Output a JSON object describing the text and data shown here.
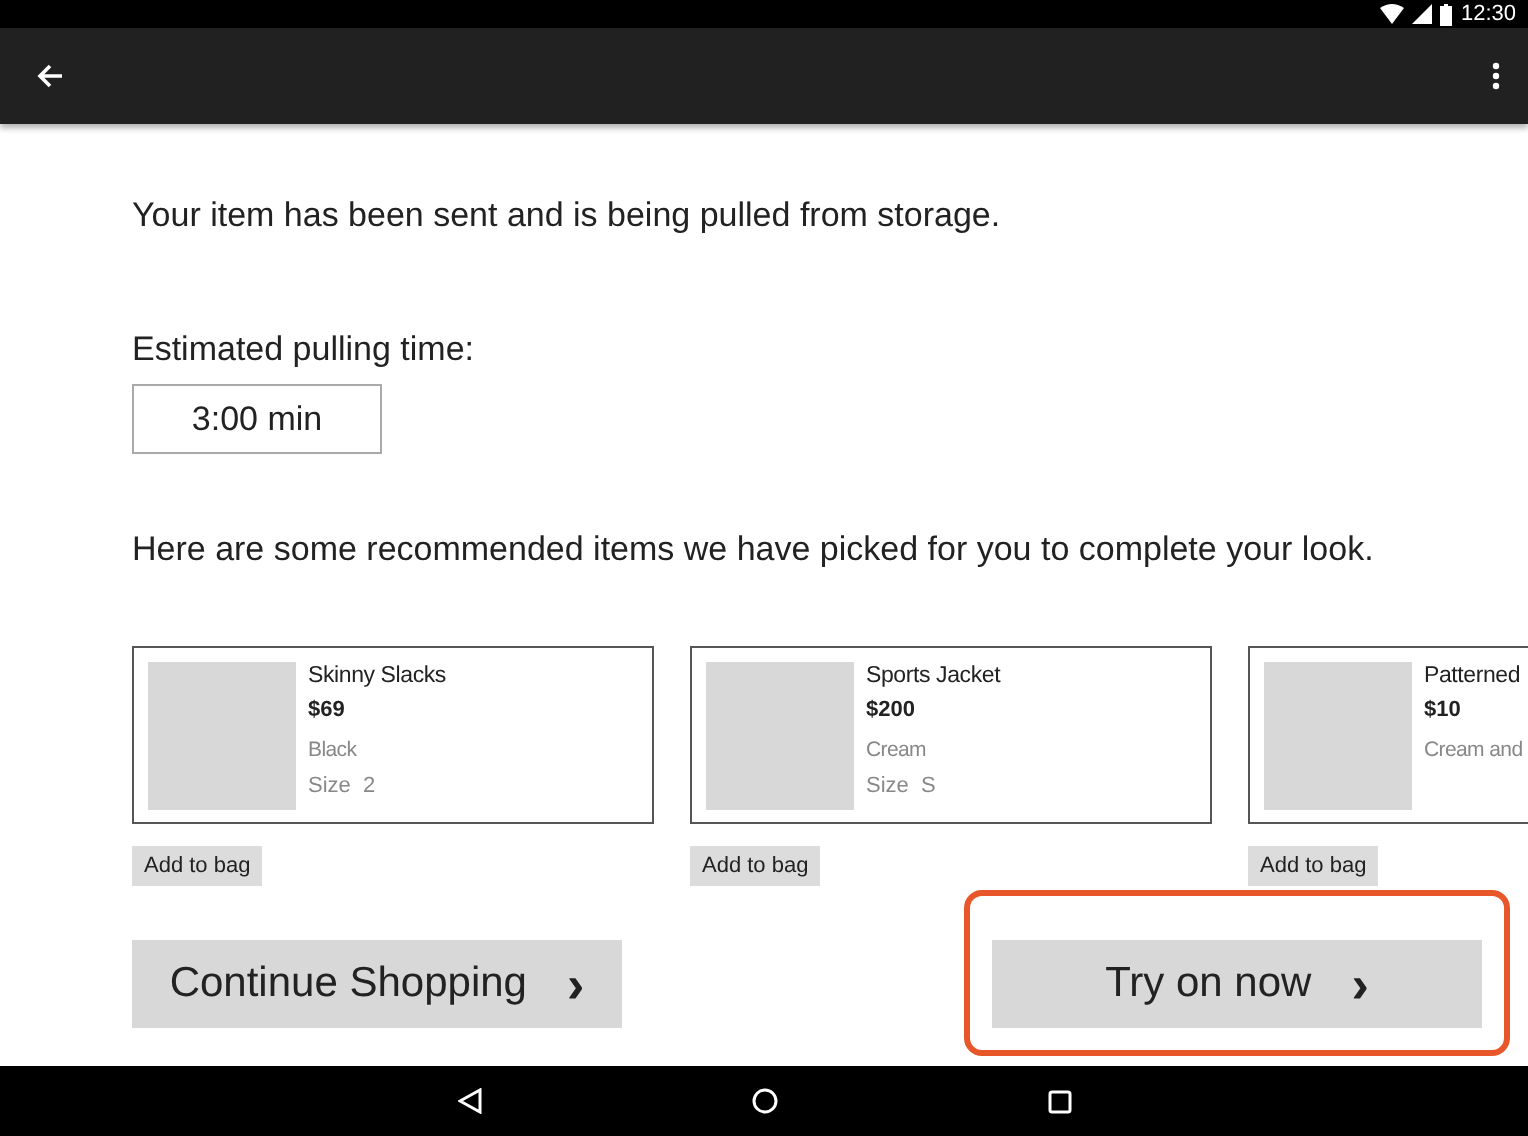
{
  "status_bar": {
    "time": "12:30"
  },
  "message": "Your item has been sent and is being pulled from storage.",
  "estimate": {
    "label": "Estimated pulling time:",
    "value": "3:00 min"
  },
  "recommendation_text": "Here are some recommended items we have picked for you to complete your look.",
  "products": [
    {
      "name": "Skinny Slacks",
      "price": "$69",
      "color_name": "Black",
      "size": "Size  2",
      "button": "Add to bag",
      "kind": "picture"
    },
    {
      "name": "Sports Jacket",
      "price": "$200",
      "color_name": "Cream",
      "size": "Size  S",
      "button": "Add to bag",
      "kind": "picture"
    },
    {
      "name": "Patterned",
      "price": "$10",
      "color_name": "Cream and",
      "button": "Add to bag",
      "kind": "picture"
    }
  ],
  "actions": [
    {
      "label": "Continue Shopping",
      "icon": "›",
      "highlighted": false
    },
    {
      "label": "Try on now",
      "icon": "›",
      "highlighted": true
    }
  ]
}
